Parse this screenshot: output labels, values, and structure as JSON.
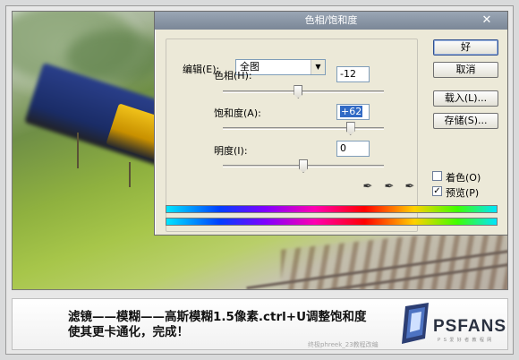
{
  "dialog": {
    "title": "色相/饱和度",
    "edit_label": "编辑(E):",
    "edit_value": "全图",
    "hue_label": "色相(H):",
    "hue_value": "-12",
    "hue_slider_value": -12,
    "saturation_label": "饱和度(A):",
    "saturation_value": "+62",
    "saturation_slider_value": 62,
    "lightness_label": "明度(I):",
    "lightness_value": "0",
    "lightness_slider_value": 0,
    "buttons": {
      "ok": "好",
      "cancel": "取消",
      "load": "载入(L)...",
      "save": "存储(S)..."
    },
    "colorize_label": "着色(O)",
    "colorize_checked": false,
    "preview_label": "预览(P)",
    "preview_checked": true
  },
  "caption": {
    "line1": "滤镜——模糊——高斯模糊1.5像素.ctrl+U调整饱和度",
    "line2": "使其更卡通化，完成！"
  },
  "logo": {
    "name": "PSFANS",
    "tagline": "P S 爱 好 者 教 程 网"
  },
  "watermark": "终极phreek_23教程改编",
  "colors": {
    "accent": "#316ac5",
    "dialog_bg": "#ece9d8"
  },
  "icons": [
    "close-icon",
    "dropdown-arrow-icon",
    "eyedropper-icon",
    "eyedropper-plus-icon",
    "eyedropper-minus-icon",
    "psfans-logo"
  ]
}
